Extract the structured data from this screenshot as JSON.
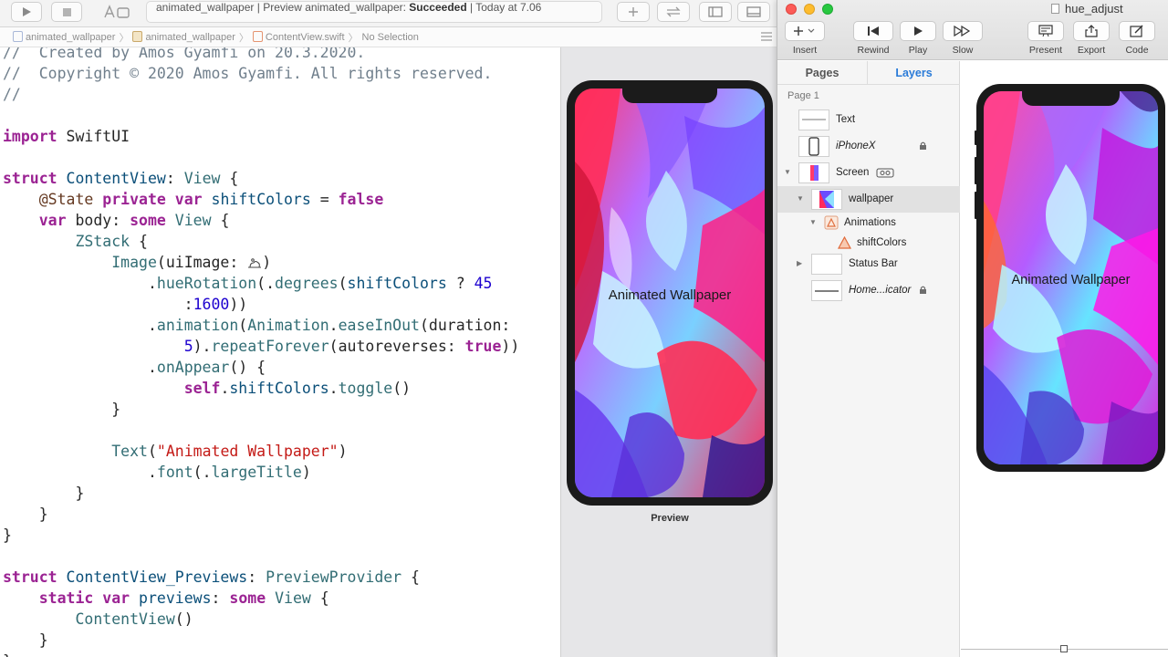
{
  "xcode": {
    "status": {
      "project": "animated_wallpaper",
      "action": "Preview animated_wallpaper:",
      "result": "Succeeded",
      "time": "Today at 7.06"
    },
    "jump_bar": [
      "animated_wallpaper",
      "animated_wallpaper",
      "ContentView.swift",
      "No Selection"
    ],
    "preview": {
      "overlay_text": "Animated Wallpaper",
      "label": "Preview"
    }
  },
  "sketch": {
    "window_title": "hue_adjust",
    "toolbar": {
      "insert": "Insert",
      "rewind": "Rewind",
      "play": "Play",
      "slow": "Slow",
      "present": "Present",
      "export": "Export",
      "code": "Code"
    },
    "tabs": {
      "pages": "Pages",
      "layers": "Layers"
    },
    "page_name": "Page 1",
    "layers": [
      {
        "name": "Text"
      },
      {
        "name": "iPhoneX"
      },
      {
        "name": "Screen"
      },
      {
        "name": "wallpaper"
      },
      {
        "name": "Animations"
      },
      {
        "name": "shiftColors"
      },
      {
        "name": "Status Bar"
      },
      {
        "name": "Home...icator"
      }
    ],
    "canvas_text": "Animated Wallpaper"
  }
}
